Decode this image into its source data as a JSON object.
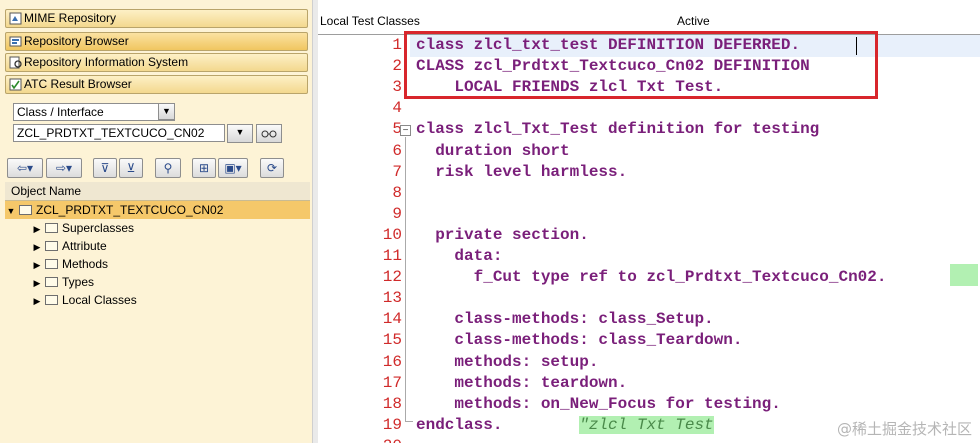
{
  "left_panel": {
    "nav_buttons": [
      {
        "label": "MIME Repository",
        "icon": "mime-icon"
      },
      {
        "label": "Repository Browser",
        "icon": "repository-browser-icon"
      },
      {
        "label": "Repository Information System",
        "icon": "info-system-icon"
      },
      {
        "label": "ATC Result Browser",
        "icon": "atc-icon"
      }
    ],
    "object_type": {
      "value": "Class / Interface"
    },
    "object_name_field": {
      "value": "ZCL_PRDTXT_TEXTCUCO_CN02"
    },
    "tree_header": "Object Name",
    "tree": {
      "root": "ZCL_PRDTXT_TEXTCUCO_CN02",
      "children": [
        "Superclasses",
        "Attribute",
        "Methods",
        "Types",
        "Local Classes"
      ]
    }
  },
  "editor": {
    "tab_label": "Local Test Classes",
    "status": "Active",
    "lines": [
      {
        "num": "1",
        "text": "class zlcl_txt_test DEFINITION DEFERRED."
      },
      {
        "num": "2",
        "text": "CLASS zcl_Prdtxt_Textcuco_Cn02 DEFINITION"
      },
      {
        "num": "3",
        "text": "    LOCAL FRIENDS zlcl Txt Test."
      },
      {
        "num": "4",
        "text": ""
      },
      {
        "num": "5",
        "text": "class zlcl_Txt_Test definition for testing"
      },
      {
        "num": "6",
        "text": "  duration short"
      },
      {
        "num": "7",
        "text": "  risk level harmless."
      },
      {
        "num": "8",
        "text": ""
      },
      {
        "num": "9",
        "text": ""
      },
      {
        "num": "10",
        "text": "  private section."
      },
      {
        "num": "11",
        "text": "    data:"
      },
      {
        "num": "12",
        "text": "      f_Cut type ref to zcl_Prdtxt_Textcuco_Cn02."
      },
      {
        "num": "13",
        "text": ""
      },
      {
        "num": "14",
        "text": "    class-methods: class_Setup."
      },
      {
        "num": "15",
        "text": "    class-methods: class_Teardown."
      },
      {
        "num": "16",
        "text": "    methods: setup."
      },
      {
        "num": "17",
        "text": "    methods: teardown."
      },
      {
        "num": "18",
        "text": "    methods: on_New_Focus for testing."
      },
      {
        "num": "19",
        "text": "endclass."
      },
      {
        "num": "20",
        "text": ""
      }
    ],
    "line19_comment": "\"zlcl Txt Test"
  },
  "watermark": "@稀土掘金技术社区",
  "colors": {
    "keyword": "#7a1f7a",
    "line_number": "#d02a2a",
    "highlight_box": "#d8262c",
    "nav_accent": "#f5c86a"
  }
}
